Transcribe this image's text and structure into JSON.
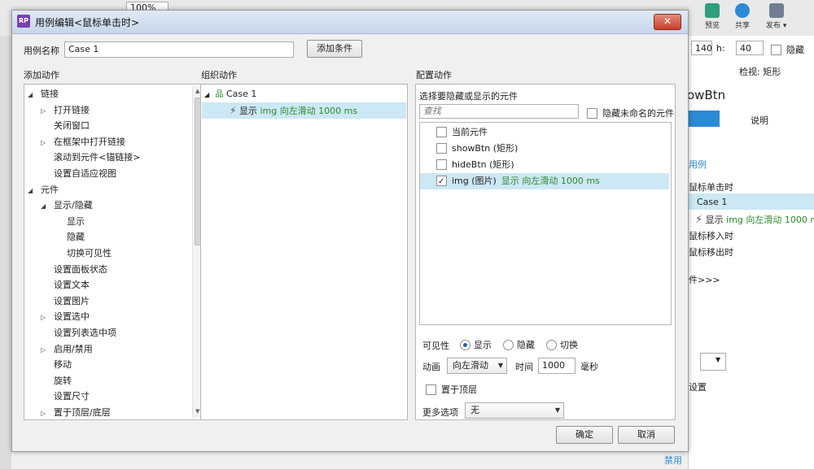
{
  "background_app": {
    "toolbar": {
      "zoom_value": "100%",
      "preview_label": "预览",
      "share_label": "共享",
      "publish_label": "发布 ▾"
    },
    "inspector": {
      "width_value": "140",
      "h_label": "h:",
      "height_value": "40",
      "hide_label": "隐藏",
      "panel_title": "检视: 矩形",
      "widget_name": "owBtn",
      "tab_active": "",
      "tab_notes": "说明",
      "use_case_link": "用例",
      "event_click": "鼠标单击时",
      "case_label": "Case 1",
      "action_prefix": "显示",
      "action_detail": "img 向左滑动 1000 ms",
      "event_enter": "鼠标移入时",
      "event_leave": "鼠标移出时",
      "more_events": "件>>>",
      "settings_label": "设置",
      "disable_label": "禁用"
    }
  },
  "dialog": {
    "title": "用例编辑<鼠标单击时>",
    "app_icon_text": "RP",
    "close_glyph": "✕",
    "case_name_label": "用例名称",
    "case_name_value": "Case 1",
    "add_condition_button": "添加条件",
    "ok_button": "确定",
    "cancel_button": "取消"
  },
  "add_actions": {
    "heading": "添加动作",
    "items": [
      {
        "label": "链接",
        "level": 0,
        "toggle": "open"
      },
      {
        "label": "打开链接",
        "level": 1,
        "toggle": "closed"
      },
      {
        "label": "关闭窗口",
        "level": 1,
        "toggle": "none"
      },
      {
        "label": "在框架中打开链接",
        "level": 1,
        "toggle": "closed"
      },
      {
        "label": "滚动到元件<锚链接>",
        "level": 1,
        "toggle": "none"
      },
      {
        "label": "设置自适应视图",
        "level": 1,
        "toggle": "none"
      },
      {
        "label": "元件",
        "level": 0,
        "toggle": "open"
      },
      {
        "label": "显示/隐藏",
        "level": 1,
        "toggle": "open"
      },
      {
        "label": "显示",
        "level": 2,
        "toggle": "none"
      },
      {
        "label": "隐藏",
        "level": 2,
        "toggle": "none"
      },
      {
        "label": "切换可见性",
        "level": 2,
        "toggle": "none"
      },
      {
        "label": "设置面板状态",
        "level": 1,
        "toggle": "none"
      },
      {
        "label": "设置文本",
        "level": 1,
        "toggle": "none"
      },
      {
        "label": "设置图片",
        "level": 1,
        "toggle": "none"
      },
      {
        "label": "设置选中",
        "level": 1,
        "toggle": "closed"
      },
      {
        "label": "设置列表选中项",
        "level": 1,
        "toggle": "none"
      },
      {
        "label": "启用/禁用",
        "level": 1,
        "toggle": "closed"
      },
      {
        "label": "移动",
        "level": 1,
        "toggle": "none"
      },
      {
        "label": "旋转",
        "level": 1,
        "toggle": "none"
      },
      {
        "label": "设置尺寸",
        "level": 1,
        "toggle": "none"
      },
      {
        "label": "置于顶层/底层",
        "level": 1,
        "toggle": "closed"
      }
    ]
  },
  "organize_actions": {
    "heading": "组织动作",
    "case_label": "Case 1",
    "action_prefix": "显示",
    "action_detail": "img 向左滑动 1000 ms"
  },
  "configure_actions": {
    "heading": "配置动作",
    "subheading": "选择要隐藏或显示的元件",
    "search_placeholder": "查找",
    "hide_unnamed_label": "隐藏未命名的元件",
    "widgets": [
      {
        "label": "当前元件",
        "extra": "",
        "checked": false
      },
      {
        "label": "showBtn (矩形)",
        "extra": "",
        "checked": false
      },
      {
        "label": "hideBtn (矩形)",
        "extra": "",
        "checked": false
      },
      {
        "label": "img (图片)",
        "extra": "显示 向左滑动 1000 ms",
        "checked": true
      }
    ],
    "visibility_label": "可见性",
    "visibility_options": [
      "显示",
      "隐藏",
      "切换"
    ],
    "visibility_selected": "显示",
    "animation_label": "动画",
    "animation_value": "向左滑动",
    "time_label": "时间",
    "time_value": "1000",
    "time_unit": "毫秒",
    "bring_to_front_label": "置于顶层",
    "more_options_label": "更多选项",
    "more_options_value": "无"
  },
  "colors": {
    "selected_row": "#cce8f4",
    "green_text": "#2b8a2b",
    "title_gradient_top": "#dfe9f5"
  }
}
